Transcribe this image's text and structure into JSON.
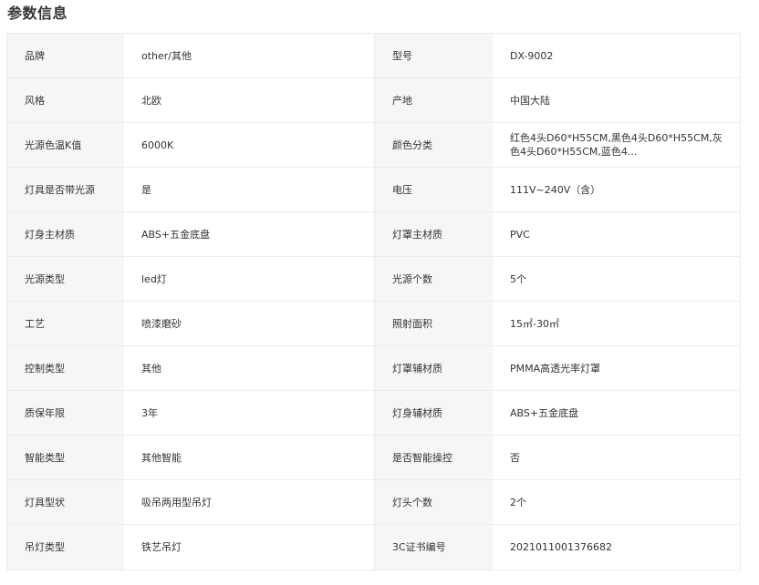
{
  "section": {
    "title": "参数信息"
  },
  "params": [
    {
      "k1": "品牌",
      "v1": "other/其他",
      "k2": "型号",
      "v2": "DX-9002"
    },
    {
      "k1": "风格",
      "v1": "北欧",
      "k2": "产地",
      "v2": "中国大陆"
    },
    {
      "k1": "光源色温K值",
      "v1": "6000K",
      "k2": "颜色分类",
      "v2": "红色4头D60*H55CM,黑色4头D60*H55CM,灰色4头D60*H55CM,蓝色4..."
    },
    {
      "k1": "灯具是否带光源",
      "v1": "是",
      "k2": "电压",
      "v2": "111V~240V（含）"
    },
    {
      "k1": "灯身主材质",
      "v1": "ABS+五金底盘",
      "k2": "灯罩主材质",
      "v2": "PVC"
    },
    {
      "k1": "光源类型",
      "v1": "led灯",
      "k2": "光源个数",
      "v2": "5个"
    },
    {
      "k1": "工艺",
      "v1": "喷漆磨砂",
      "k2": "照射面积",
      "v2": "15㎡-30㎡"
    },
    {
      "k1": "控制类型",
      "v1": "其他",
      "k2": "灯罩辅材质",
      "v2": "PMMA高透光率灯罩"
    },
    {
      "k1": "质保年限",
      "v1": "3年",
      "k2": "灯身辅材质",
      "v2": "ABS+五金底盘"
    },
    {
      "k1": "智能类型",
      "v1": "其他智能",
      "k2": "是否智能操控",
      "v2": "否"
    },
    {
      "k1": "灯具型状",
      "v1": "吸吊两用型吊灯",
      "k2": "灯头个数",
      "v2": "2个"
    },
    {
      "k1": "吊灯类型",
      "v1": "铁艺吊灯",
      "k2": "3C证书编号",
      "v2": "2021011001376682"
    }
  ]
}
